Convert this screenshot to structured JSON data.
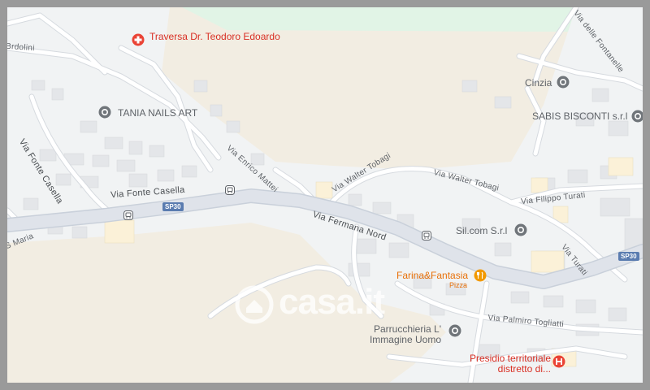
{
  "map": {
    "colors": {
      "land": "#f1f3f4",
      "rural": "#f2ede2",
      "park": "#e1f4e6",
      "road": "#ffffff",
      "major_road": "#dfe3ea",
      "building": "#e4e6e9",
      "poi_gray": "#5f6368",
      "poi_red": "#d93025",
      "poi_orange": "#e8710a",
      "shield": "#5a7cb0"
    },
    "pois": {
      "traversa": "Traversa Dr. Teodoro Edoardo",
      "tania": "TANIA NAILS ART",
      "cinzia": "Cinzia",
      "sabis": "SABIS BISCONTI s.r.l",
      "silcom": "Sil.com S.r.l",
      "farina": "Farina&Fantasia",
      "farina_sub": "Pizza",
      "parrucchieria": "Parrucchieria L' Immagine Uomo",
      "presidio": "Presidio territoriale distretto di..."
    },
    "streets": {
      "brdolini": "Brdolini",
      "fonte_casella_v": "Via Fonte Casella",
      "fonte_casella_h": "Via Fonte Casella",
      "enrico_mattei": "Via Enrico Mattei",
      "fermana_nord": "Via Fermana Nord",
      "walter_tobagi_1": "Via Walter Tobagi",
      "walter_tobagi_2": "Via Walter Tobagi",
      "filippo_turati": "Via Filippo Turati",
      "turati": "Via Turati",
      "palmiro_togliatti": "Via Palmiro Togliatti",
      "s_maria": "S Maria",
      "fontanelle": "Via delle Fontanelle"
    },
    "shields": {
      "a": "SP30",
      "b": "SP30"
    },
    "icons": [
      "hospital-icon",
      "shop-icon",
      "restaurant-icon",
      "bus-stop-icon"
    ],
    "watermark": "casa.it"
  }
}
